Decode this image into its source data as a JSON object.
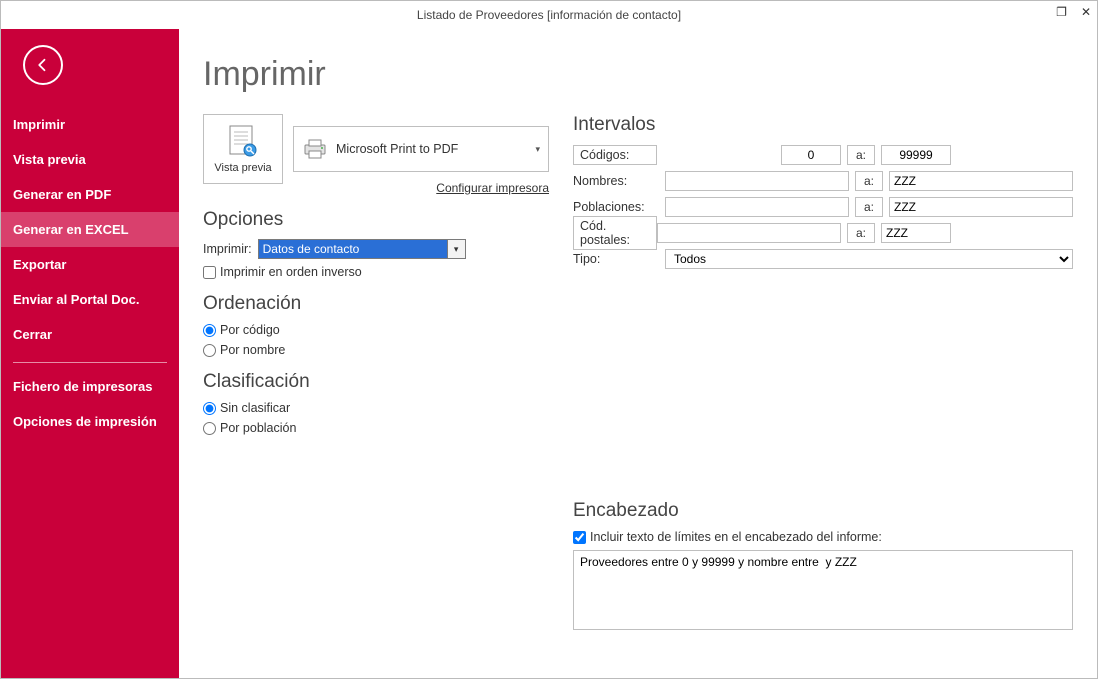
{
  "window": {
    "title": "Listado de Proveedores [información de contacto]",
    "maximize_glyph": "❐",
    "close_glyph": "✕"
  },
  "sidebar": {
    "items": [
      {
        "label": "Imprimir"
      },
      {
        "label": "Vista previa"
      },
      {
        "label": "Generar en PDF"
      },
      {
        "label": "Generar en EXCEL"
      },
      {
        "label": "Exportar"
      },
      {
        "label": "Enviar al Portal Doc."
      },
      {
        "label": "Cerrar"
      }
    ],
    "items2": [
      {
        "label": "Fichero de impresoras"
      },
      {
        "label": "Opciones de impresión"
      }
    ]
  },
  "page": {
    "heading": "Imprimir",
    "preview_label": "Vista previa",
    "printer_name": "Microsoft Print to PDF",
    "configure_link": "Configurar impresora"
  },
  "opciones": {
    "heading": "Opciones",
    "imprimir_label": "Imprimir:",
    "imprimir_value": "Datos de contacto",
    "reverse_label": "Imprimir en orden inverso"
  },
  "ordenacion": {
    "heading": "Ordenación",
    "por_codigo": "Por código",
    "por_nombre": "Por nombre"
  },
  "clasificacion": {
    "heading": "Clasificación",
    "sin_clasificar": "Sin clasificar",
    "por_poblacion": "Por población"
  },
  "intervalos": {
    "heading": "Intervalos",
    "a_label": "a:",
    "codigos": {
      "label": "Códigos:",
      "from": "0",
      "to": "99999"
    },
    "nombres": {
      "label": "Nombres:",
      "from": "",
      "to": "ZZZ"
    },
    "poblaciones": {
      "label": "Poblaciones:",
      "from": "",
      "to": "ZZZ"
    },
    "codpostales": {
      "label": "Cód. postales:",
      "from": "",
      "to": "ZZZ"
    },
    "tipo": {
      "label": "Tipo:",
      "value": "Todos"
    }
  },
  "encabezado": {
    "heading": "Encabezado",
    "checkbox_label": "Incluir texto de límites en el encabezado del informe:",
    "text": "Proveedores entre 0 y 99999 y nombre entre  y ZZZ"
  }
}
